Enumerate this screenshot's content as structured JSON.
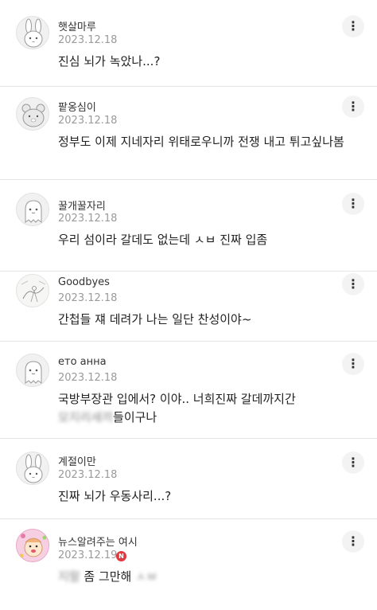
{
  "comments": [
    {
      "author": "햇살마루",
      "date": "2023.12.18",
      "text": "진심 뇌가 녹았나...?",
      "avatar": "bunny-avatar-icon"
    },
    {
      "author": "팥옹심이",
      "date": "2023.12.18",
      "text": "정부도 이제 지네자리 위태로우니까 전쟁 내고 튀고싶나봄",
      "avatar": "bear-avatar-icon"
    },
    {
      "author": "꿀개꿀자리",
      "date": "2023.12.18",
      "text": "우리 섬이라 갈데도 없는데 ㅅㅂ 진짜 입좀",
      "avatar": "ghost-avatar-icon"
    },
    {
      "author": "Goodbyes",
      "date": "2023.12.18",
      "text": "간첩들 쟤 데려가 나는 일단 찬성이야~",
      "avatar": "sketch-avatar-icon"
    },
    {
      "author": "ето анна",
      "date": "2023.12.18",
      "text_visible": "국방부장관 입에서? 이야.. 너희진짜 갈데까지간",
      "text_blurred": "모지리새끼",
      "text_tail": "들이구나",
      "avatar": "ghost-avatar-icon"
    },
    {
      "author": "계절이만",
      "date": "2023.12.18",
      "text": "진짜 뇌가 우동사리...?",
      "avatar": "bunny-avatar-icon"
    },
    {
      "author": "뉴스알려주는 여시",
      "date": "2023.12.19",
      "new_badge": "N",
      "text_blurred": "지랄",
      "text_mid": " 좀 그만해 ",
      "text_tail": "ㅅㅂ",
      "avatar": "cartoon-character-avatar-icon"
    }
  ],
  "more_button_icon": "more-vertical-icon",
  "more_button_glyph": "⋮",
  "colors": {
    "date": "#9a9a9a",
    "divider": "#e6e6e6",
    "badge": "#e0393e",
    "avatar_bg": "#f1f1f1"
  }
}
